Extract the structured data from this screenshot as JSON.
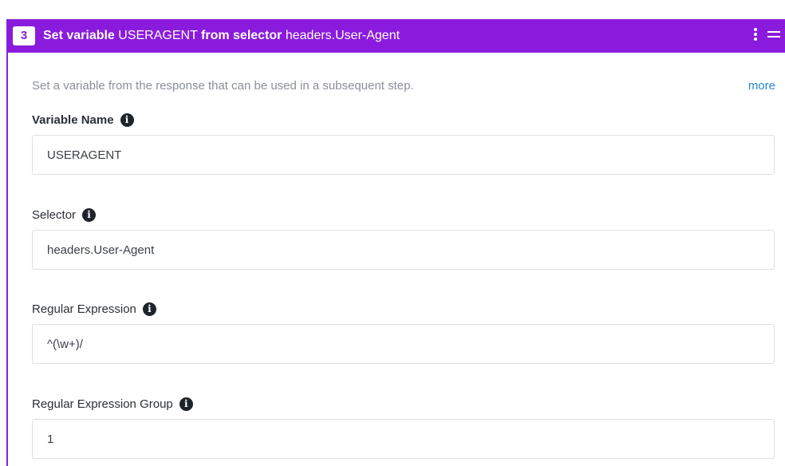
{
  "step": {
    "number": "3",
    "title_action": "Set variable",
    "title_variable": "USERAGENT",
    "title_from": "from selector",
    "title_selector": "headers.User-Agent"
  },
  "header_icons": [
    "kebab-menu-icon",
    "drag-handle-icon"
  ],
  "description": "Set a variable from the response that can be used in a subsequent step.",
  "more_link": "more",
  "fields": {
    "variable_name": {
      "label": "Variable Name",
      "value": "USERAGENT"
    },
    "selector": {
      "label": "Selector",
      "value": "headers.User-Agent"
    },
    "regex": {
      "label": "Regular Expression",
      "value": "^(\\w+)/"
    },
    "regex_group": {
      "label": "Regular Expression Group",
      "value": "1"
    }
  },
  "info_glyph": "i",
  "colors": {
    "accent": "#8a1bdc",
    "link": "#2a86d1",
    "muted_text": "#8a8f99"
  }
}
